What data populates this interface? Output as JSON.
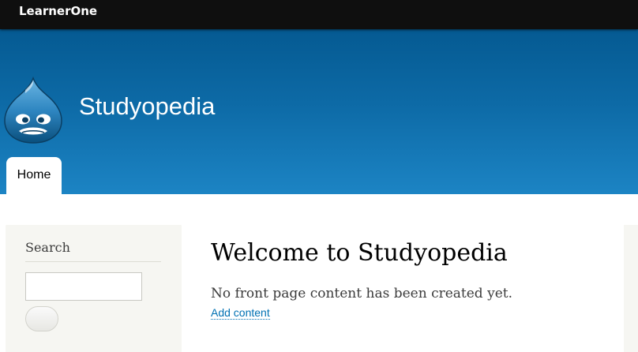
{
  "toolbar": {
    "user_label": "LearnerOne"
  },
  "header": {
    "logo_icon": "drupal-drop-icon",
    "site_name": "Studyopedia"
  },
  "nav": {
    "tabs": [
      {
        "label": "Home",
        "active": true
      }
    ]
  },
  "sidebar": {
    "search_block": {
      "title": "Search",
      "input_value": "",
      "button_label": ""
    }
  },
  "main": {
    "title": "Welcome to Studyopedia",
    "empty_message": "No front page content has been created yet.",
    "add_content_link": "Add content"
  },
  "colors": {
    "toolbar_bg": "#0f0f0f",
    "header_top": "#055a92",
    "header_bottom": "#1c84c4",
    "sidebar_bg": "#f6f6f2",
    "link": "#0071b3"
  }
}
